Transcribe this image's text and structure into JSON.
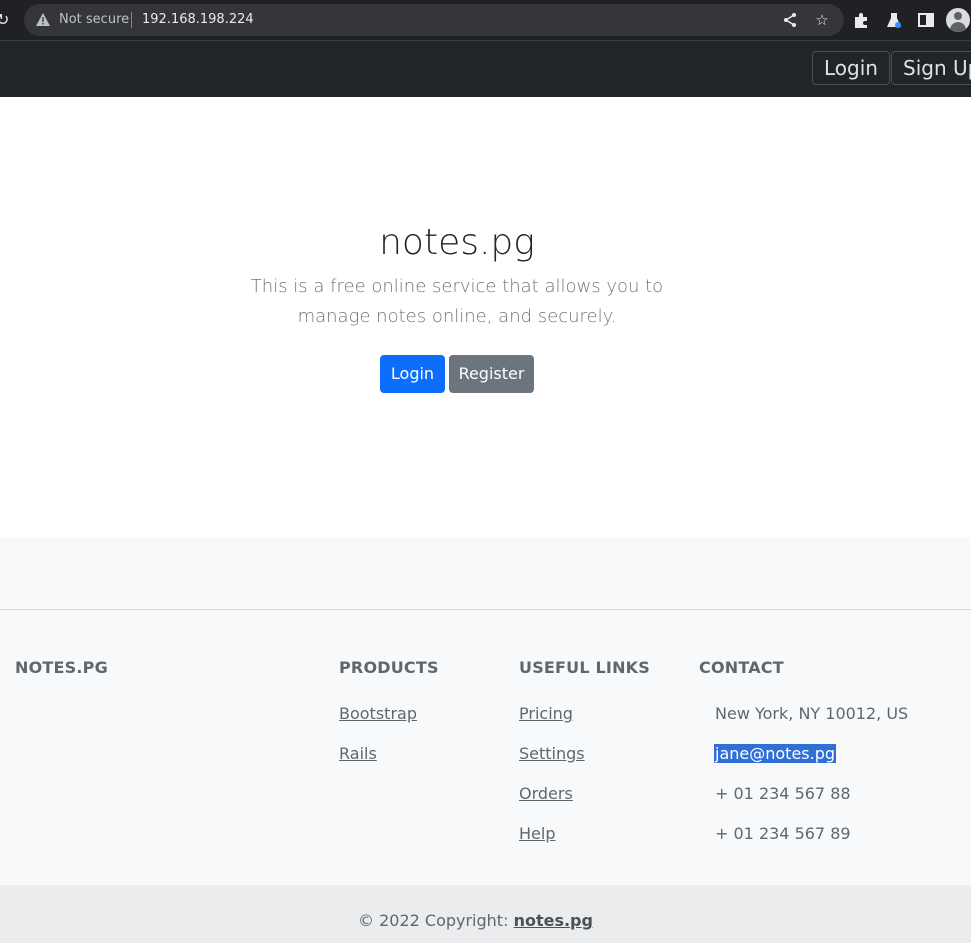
{
  "browser": {
    "security_label": "Not secure",
    "url": "192.168.198.224",
    "icons": [
      "reload-icon",
      "warning-icon",
      "share-icon",
      "star-icon",
      "extensions-icon",
      "labs-icon",
      "side-panel-icon",
      "profile-icon"
    ]
  },
  "navbar": {
    "login_label": "Login",
    "signup_label": "Sign Up"
  },
  "hero": {
    "title": "notes.pg",
    "lead": "This is a free online service that allows you to manage notes online, and securely.",
    "login_button": "Login",
    "register_button": "Register"
  },
  "footer": {
    "brand": "NOTES.PG",
    "products": {
      "heading": "PRODUCTS",
      "links": [
        "Bootstrap",
        "Rails"
      ]
    },
    "useful_links": {
      "heading": "USEFUL LINKS",
      "links": [
        "Pricing",
        "Settings",
        "Orders",
        "Help"
      ]
    },
    "contact": {
      "heading": "CONTACT",
      "address": "New York, NY 10012, US",
      "email": "jane@notes.pg",
      "phone1": "+ 01 234 567 88",
      "phone2": "+ 01 234 567 89"
    },
    "copyright_prefix": "© 2022 Copyright:",
    "copyright_link": "notes.pg"
  },
  "colors": {
    "primary": "#0d6efd",
    "secondary": "#6c757d",
    "navbar": "#212529",
    "footer_bg": "#f8f9fa",
    "selection": "#2f6fd6"
  }
}
